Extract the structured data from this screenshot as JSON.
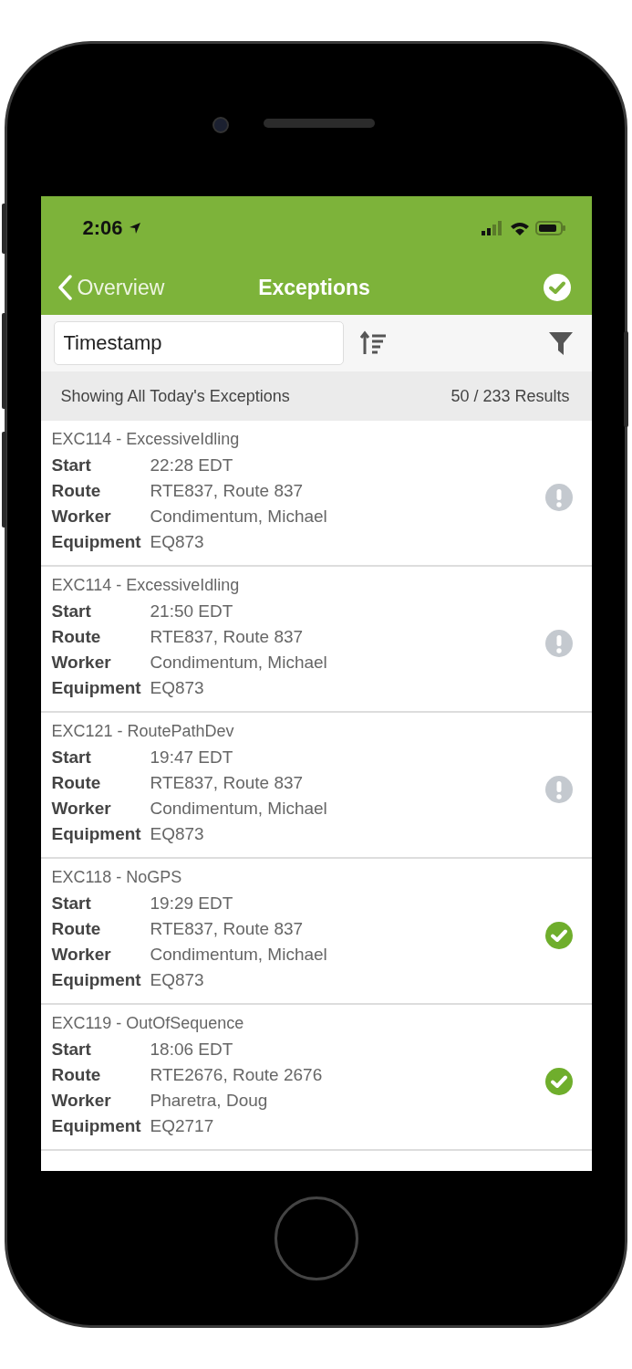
{
  "status_bar": {
    "time": "2:06"
  },
  "nav": {
    "back": "Overview",
    "title": "Exceptions"
  },
  "toolbar": {
    "sort_field": "Timestamp"
  },
  "summary": {
    "label": "Showing All Today's Exceptions",
    "count": "50 / 233 Results"
  },
  "exceptions": [
    {
      "title": "EXC114 - ExcessiveIdling",
      "resolved": false,
      "fields": [
        {
          "label": "Start",
          "value": "22:28 EDT"
        },
        {
          "label": "Route",
          "value": "RTE837, Route 837"
        },
        {
          "label": "Worker",
          "value": "Condimentum, Michael"
        },
        {
          "label": "Equipment",
          "value": "EQ873"
        }
      ]
    },
    {
      "title": "EXC114 - ExcessiveIdling",
      "resolved": false,
      "fields": [
        {
          "label": "Start",
          "value": "21:50 EDT"
        },
        {
          "label": "Route",
          "value": "RTE837, Route 837"
        },
        {
          "label": "Worker",
          "value": "Condimentum, Michael"
        },
        {
          "label": "Equipment",
          "value": "EQ873"
        }
      ]
    },
    {
      "title": "EXC121 - RoutePathDev",
      "resolved": false,
      "fields": [
        {
          "label": "Start",
          "value": "19:47 EDT"
        },
        {
          "label": "Route",
          "value": "RTE837, Route 837"
        },
        {
          "label": "Worker",
          "value": "Condimentum, Michael"
        },
        {
          "label": "Equipment",
          "value": "EQ873"
        }
      ]
    },
    {
      "title": "EXC118 - NoGPS",
      "resolved": true,
      "fields": [
        {
          "label": "Start",
          "value": "19:29 EDT"
        },
        {
          "label": "Route",
          "value": "RTE837, Route 837"
        },
        {
          "label": "Worker",
          "value": "Condimentum, Michael"
        },
        {
          "label": "Equipment",
          "value": "EQ873"
        }
      ]
    },
    {
      "title": "EXC119 - OutOfSequence",
      "resolved": true,
      "fields": [
        {
          "label": "Start",
          "value": "18:06 EDT"
        },
        {
          "label": "Route",
          "value": "RTE2676, Route 2676"
        },
        {
          "label": "Worker",
          "value": "Pharetra, Doug"
        },
        {
          "label": "Equipment",
          "value": "EQ2717"
        }
      ]
    }
  ]
}
